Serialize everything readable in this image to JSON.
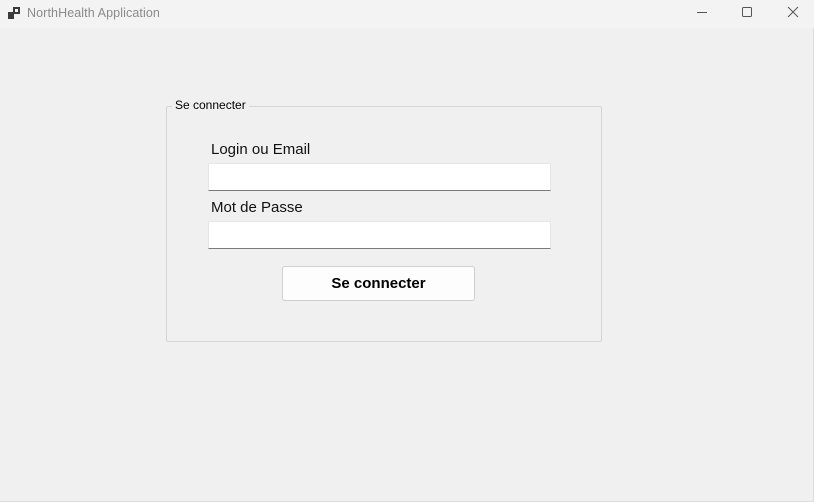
{
  "window": {
    "title": "NorthHealth Application",
    "controls": {
      "minimize": "minimize-icon",
      "maximize": "maximize-icon",
      "close": "close-icon"
    }
  },
  "login_group": {
    "legend": "Se connecter",
    "login_label": "Login ou Email",
    "login_value": "",
    "password_label": "Mot de Passe",
    "password_value": "",
    "submit_label": "Se connecter"
  },
  "colors": {
    "background": "#f0f0f0",
    "titlebar": "#f3f3f3",
    "title_text": "#8a8a8a",
    "input_background": "#ffffff"
  }
}
